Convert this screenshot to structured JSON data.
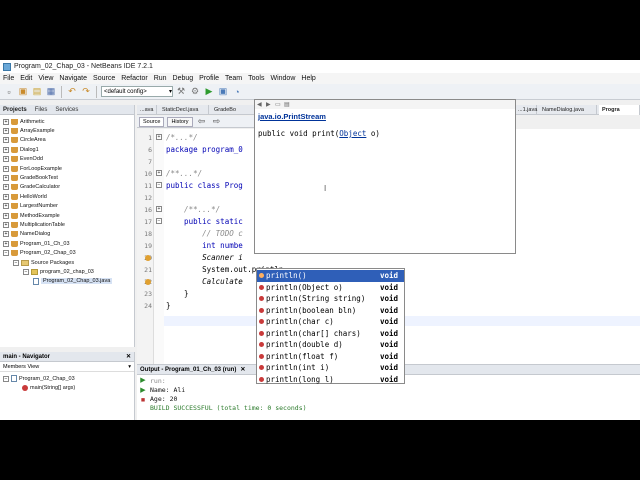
{
  "window": {
    "title": "Program_02_Chap_03 - NetBeans IDE 7.2.1"
  },
  "menu": [
    "File",
    "Edit",
    "View",
    "Navigate",
    "Source",
    "Refactor",
    "Run",
    "Debug",
    "Profile",
    "Team",
    "Tools",
    "Window",
    "Help"
  ],
  "toolbar": {
    "config_value": "<default config>"
  },
  "projects_panel": {
    "tabs": [
      "Projects",
      "Files",
      "Services"
    ],
    "tree": [
      {
        "label": "Arithmetic",
        "level": 0,
        "kind": "project",
        "expanded": false
      },
      {
        "label": "ArrayExample",
        "level": 0,
        "kind": "project",
        "expanded": false
      },
      {
        "label": "CircleArea",
        "level": 0,
        "kind": "project",
        "expanded": false
      },
      {
        "label": "Dialog1",
        "level": 0,
        "kind": "project",
        "expanded": false
      },
      {
        "label": "EvenOdd",
        "level": 0,
        "kind": "project",
        "expanded": false
      },
      {
        "label": "ForLoopExample",
        "level": 0,
        "kind": "project",
        "expanded": false
      },
      {
        "label": "GradeBookTest",
        "level": 0,
        "kind": "project",
        "expanded": false
      },
      {
        "label": "GradeCalculator",
        "level": 0,
        "kind": "project",
        "expanded": false
      },
      {
        "label": "HelloWorld",
        "level": 0,
        "kind": "project",
        "expanded": false
      },
      {
        "label": "LargestNumber",
        "level": 0,
        "kind": "project",
        "expanded": false
      },
      {
        "label": "MethodExample",
        "level": 0,
        "kind": "project",
        "expanded": false
      },
      {
        "label": "MultiplicationTable",
        "level": 0,
        "kind": "project",
        "expanded": false
      },
      {
        "label": "NameDialog",
        "level": 0,
        "kind": "project",
        "expanded": false
      },
      {
        "label": "Program_01_Ch_03",
        "level": 0,
        "kind": "project",
        "expanded": false
      },
      {
        "label": "Program_02_Chap_03",
        "level": 0,
        "kind": "project",
        "expanded": true
      },
      {
        "label": "Source Packages",
        "level": 1,
        "kind": "folder",
        "expanded": true
      },
      {
        "label": "program_02_chap_03",
        "level": 2,
        "kind": "package",
        "expanded": true
      },
      {
        "label": "Program_02_Chap_03.java",
        "level": 3,
        "kind": "file",
        "expanded": false
      }
    ]
  },
  "navigator": {
    "title": "main - Navigator",
    "view": "Members View",
    "class": "Program_02_Chap_03",
    "member": "main(String[] args)"
  },
  "editor": {
    "tabs": [
      "...ava",
      "StaticDecl.java",
      "GradeBo",
      "...1.java",
      "NameDialog.java",
      "Progra"
    ],
    "source_button": "Source",
    "history_button": "History",
    "line_numbers": [
      "1",
      "6",
      "7",
      "10",
      "11",
      "12",
      "16",
      "17",
      "18",
      "19",
      "20",
      "21",
      "22",
      "23",
      "24"
    ],
    "lines": [
      "/*...*/",
      "package program_0",
      "",
      "/**...*/",
      "public class Prog",
      "",
      "    /**...*/",
      "    public static",
      "        // TODO c",
      "        int numbe",
      "        Scanner i",
      "        System.out.println",
      "        Calculate",
      "    }",
      "}"
    ]
  },
  "javadoc": {
    "class": "java.io.PrintStream",
    "sig_prefix": "public void print(",
    "sig_link": "Object",
    "sig_suffix": " o)"
  },
  "completion": {
    "items": [
      {
        "name": "println()",
        "params": "",
        "ret": "void"
      },
      {
        "name": "println(Object o)",
        "params": "",
        "ret": "void"
      },
      {
        "name": "println(String string)",
        "params": "",
        "ret": "void"
      },
      {
        "name": "println(boolean bln)",
        "params": "",
        "ret": "void"
      },
      {
        "name": "println(char c)",
        "params": "",
        "ret": "void"
      },
      {
        "name": "println(char[] chars)",
        "params": "",
        "ret": "void"
      },
      {
        "name": "println(double d)",
        "params": "",
        "ret": "void"
      },
      {
        "name": "println(float f)",
        "params": "",
        "ret": "void"
      },
      {
        "name": "println(int i)",
        "params": "",
        "ret": "void"
      },
      {
        "name": "println(long l)",
        "params": "",
        "ret": "void"
      }
    ],
    "selected_index": 0
  },
  "output": {
    "title": "Output - Program_01_Ch_03 (run)",
    "lines": [
      "run:",
      "Name: Ali",
      "Age: 20",
      "BUILD SUCCESSFUL (total time: 0 seconds)"
    ]
  },
  "colors": {
    "keyword": "#0000b4",
    "selection": "#2f5fb8",
    "link": "#003399"
  }
}
